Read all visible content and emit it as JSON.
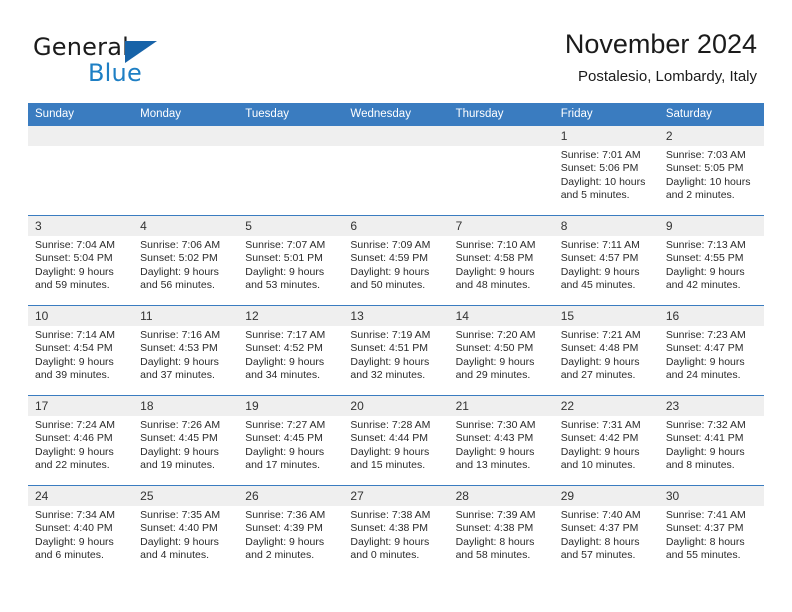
{
  "brand": {
    "name_part1": "General",
    "name_part2": "Blue",
    "logo_icon": "blue-triangle-flag-icon"
  },
  "header": {
    "title": "November 2024",
    "subtitle": "Postalesio, Lombardy, Italy"
  },
  "colors": {
    "header_blue": "#3a7cc0",
    "brand_blue": "#1e7fc4",
    "daynum_background": "#efefef",
    "row_border": "#3a7cc0"
  },
  "weekdays": [
    "Sunday",
    "Monday",
    "Tuesday",
    "Wednesday",
    "Thursday",
    "Friday",
    "Saturday"
  ],
  "labels": {
    "sunrise_prefix": "Sunrise:",
    "sunset_prefix": "Sunset:",
    "daylight_prefix": "Daylight:"
  },
  "weeks": [
    [
      {
        "day": "",
        "empty": true
      },
      {
        "day": "",
        "empty": true
      },
      {
        "day": "",
        "empty": true
      },
      {
        "day": "",
        "empty": true
      },
      {
        "day": "",
        "empty": true
      },
      {
        "day": "1",
        "sunrise": "Sunrise: 7:01 AM",
        "sunset": "Sunset: 5:06 PM",
        "daylight": "Daylight: 10 hours and 5 minutes."
      },
      {
        "day": "2",
        "sunrise": "Sunrise: 7:03 AM",
        "sunset": "Sunset: 5:05 PM",
        "daylight": "Daylight: 10 hours and 2 minutes."
      }
    ],
    [
      {
        "day": "3",
        "sunrise": "Sunrise: 7:04 AM",
        "sunset": "Sunset: 5:04 PM",
        "daylight": "Daylight: 9 hours and 59 minutes."
      },
      {
        "day": "4",
        "sunrise": "Sunrise: 7:06 AM",
        "sunset": "Sunset: 5:02 PM",
        "daylight": "Daylight: 9 hours and 56 minutes."
      },
      {
        "day": "5",
        "sunrise": "Sunrise: 7:07 AM",
        "sunset": "Sunset: 5:01 PM",
        "daylight": "Daylight: 9 hours and 53 minutes."
      },
      {
        "day": "6",
        "sunrise": "Sunrise: 7:09 AM",
        "sunset": "Sunset: 4:59 PM",
        "daylight": "Daylight: 9 hours and 50 minutes."
      },
      {
        "day": "7",
        "sunrise": "Sunrise: 7:10 AM",
        "sunset": "Sunset: 4:58 PM",
        "daylight": "Daylight: 9 hours and 48 minutes."
      },
      {
        "day": "8",
        "sunrise": "Sunrise: 7:11 AM",
        "sunset": "Sunset: 4:57 PM",
        "daylight": "Daylight: 9 hours and 45 minutes."
      },
      {
        "day": "9",
        "sunrise": "Sunrise: 7:13 AM",
        "sunset": "Sunset: 4:55 PM",
        "daylight": "Daylight: 9 hours and 42 minutes."
      }
    ],
    [
      {
        "day": "10",
        "sunrise": "Sunrise: 7:14 AM",
        "sunset": "Sunset: 4:54 PM",
        "daylight": "Daylight: 9 hours and 39 minutes."
      },
      {
        "day": "11",
        "sunrise": "Sunrise: 7:16 AM",
        "sunset": "Sunset: 4:53 PM",
        "daylight": "Daylight: 9 hours and 37 minutes."
      },
      {
        "day": "12",
        "sunrise": "Sunrise: 7:17 AM",
        "sunset": "Sunset: 4:52 PM",
        "daylight": "Daylight: 9 hours and 34 minutes."
      },
      {
        "day": "13",
        "sunrise": "Sunrise: 7:19 AM",
        "sunset": "Sunset: 4:51 PM",
        "daylight": "Daylight: 9 hours and 32 minutes."
      },
      {
        "day": "14",
        "sunrise": "Sunrise: 7:20 AM",
        "sunset": "Sunset: 4:50 PM",
        "daylight": "Daylight: 9 hours and 29 minutes."
      },
      {
        "day": "15",
        "sunrise": "Sunrise: 7:21 AM",
        "sunset": "Sunset: 4:48 PM",
        "daylight": "Daylight: 9 hours and 27 minutes."
      },
      {
        "day": "16",
        "sunrise": "Sunrise: 7:23 AM",
        "sunset": "Sunset: 4:47 PM",
        "daylight": "Daylight: 9 hours and 24 minutes."
      }
    ],
    [
      {
        "day": "17",
        "sunrise": "Sunrise: 7:24 AM",
        "sunset": "Sunset: 4:46 PM",
        "daylight": "Daylight: 9 hours and 22 minutes."
      },
      {
        "day": "18",
        "sunrise": "Sunrise: 7:26 AM",
        "sunset": "Sunset: 4:45 PM",
        "daylight": "Daylight: 9 hours and 19 minutes."
      },
      {
        "day": "19",
        "sunrise": "Sunrise: 7:27 AM",
        "sunset": "Sunset: 4:45 PM",
        "daylight": "Daylight: 9 hours and 17 minutes."
      },
      {
        "day": "20",
        "sunrise": "Sunrise: 7:28 AM",
        "sunset": "Sunset: 4:44 PM",
        "daylight": "Daylight: 9 hours and 15 minutes."
      },
      {
        "day": "21",
        "sunrise": "Sunrise: 7:30 AM",
        "sunset": "Sunset: 4:43 PM",
        "daylight": "Daylight: 9 hours and 13 minutes."
      },
      {
        "day": "22",
        "sunrise": "Sunrise: 7:31 AM",
        "sunset": "Sunset: 4:42 PM",
        "daylight": "Daylight: 9 hours and 10 minutes."
      },
      {
        "day": "23",
        "sunrise": "Sunrise: 7:32 AM",
        "sunset": "Sunset: 4:41 PM",
        "daylight": "Daylight: 9 hours and 8 minutes."
      }
    ],
    [
      {
        "day": "24",
        "sunrise": "Sunrise: 7:34 AM",
        "sunset": "Sunset: 4:40 PM",
        "daylight": "Daylight: 9 hours and 6 minutes."
      },
      {
        "day": "25",
        "sunrise": "Sunrise: 7:35 AM",
        "sunset": "Sunset: 4:40 PM",
        "daylight": "Daylight: 9 hours and 4 minutes."
      },
      {
        "day": "26",
        "sunrise": "Sunrise: 7:36 AM",
        "sunset": "Sunset: 4:39 PM",
        "daylight": "Daylight: 9 hours and 2 minutes."
      },
      {
        "day": "27",
        "sunrise": "Sunrise: 7:38 AM",
        "sunset": "Sunset: 4:38 PM",
        "daylight": "Daylight: 9 hours and 0 minutes."
      },
      {
        "day": "28",
        "sunrise": "Sunrise: 7:39 AM",
        "sunset": "Sunset: 4:38 PM",
        "daylight": "Daylight: 8 hours and 58 minutes."
      },
      {
        "day": "29",
        "sunrise": "Sunrise: 7:40 AM",
        "sunset": "Sunset: 4:37 PM",
        "daylight": "Daylight: 8 hours and 57 minutes."
      },
      {
        "day": "30",
        "sunrise": "Sunrise: 7:41 AM",
        "sunset": "Sunset: 4:37 PM",
        "daylight": "Daylight: 8 hours and 55 minutes."
      }
    ]
  ]
}
